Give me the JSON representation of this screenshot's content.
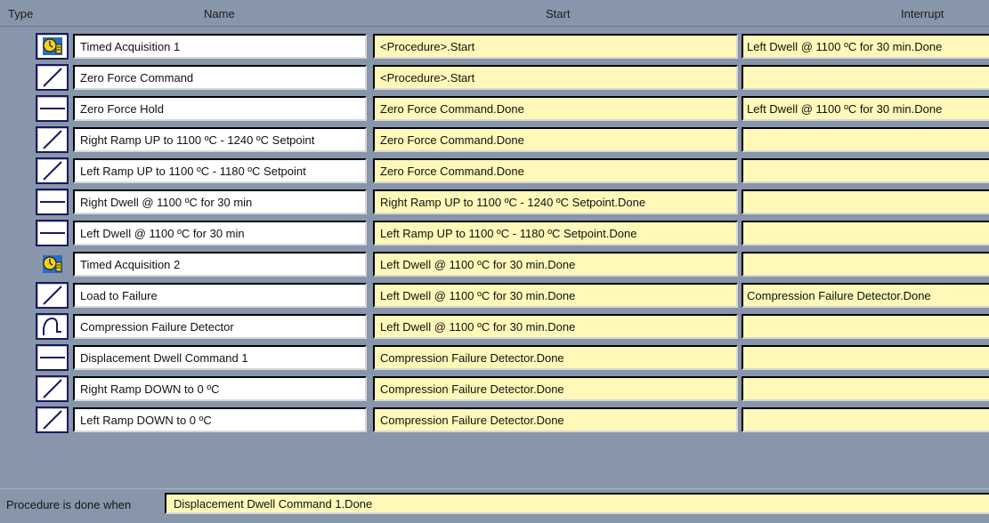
{
  "header": {
    "type": "Type",
    "name": "Name",
    "start": "Start",
    "interrupt": "Interrupt"
  },
  "rows": [
    {
      "icon": "timed-acquisition-icon",
      "name": "Timed Acquisition 1",
      "start": "<Procedure>.Start",
      "interrupt": "Left Dwell @ 1100 ºC for 30 min.Done"
    },
    {
      "icon": "ramp-icon",
      "name": "Zero Force Command",
      "start": "<Procedure>.Start",
      "interrupt": ""
    },
    {
      "icon": "dwell-icon",
      "name": "Zero Force Hold",
      "start": "Zero Force Command.Done",
      "interrupt": "Left Dwell @ 1100 ºC for 30 min.Done"
    },
    {
      "icon": "ramp-icon",
      "name": "Right Ramp UP to 1100 ºC - 1240 ºC Setpoint",
      "start": "Zero Force Command.Done",
      "interrupt": ""
    },
    {
      "icon": "ramp-icon",
      "name": "Left Ramp UP to 1100 ºC - 1180 ºC Setpoint",
      "start": "Zero Force Command.Done",
      "interrupt": ""
    },
    {
      "icon": "dwell-icon",
      "name": "Right Dwell @ 1100 ºC for 30 min",
      "start": "Right Ramp UP to 1100 ºC - 1240 ºC Setpoint.Done",
      "interrupt": ""
    },
    {
      "icon": "dwell-icon",
      "name": "Left Dwell @ 1100 ºC for 30 min",
      "start": "Left Ramp UP to 1100 ºC - 1180 ºC Setpoint.Done",
      "interrupt": ""
    },
    {
      "icon": "timed-acquisition-icon",
      "name": "Timed Acquisition 2",
      "start": "Left Dwell @ 1100 ºC for 30 min.Done",
      "interrupt": ""
    },
    {
      "icon": "ramp-icon",
      "name": "Load to Failure",
      "start": "Left Dwell @ 1100 ºC for 30 min.Done",
      "interrupt": "Compression Failure Detector.Done"
    },
    {
      "icon": "failure-detector-icon",
      "name": "Compression Failure Detector",
      "start": "Left Dwell @ 1100 ºC for 30 min.Done",
      "interrupt": ""
    },
    {
      "icon": "dwell-icon",
      "name": "Displacement Dwell Command 1",
      "start": "Compression Failure Detector.Done",
      "interrupt": ""
    },
    {
      "icon": "ramp-icon",
      "name": "Right Ramp DOWN to 0 ºC",
      "start": "Compression Failure Detector.Done",
      "interrupt": ""
    },
    {
      "icon": "ramp-icon",
      "name": "Left Ramp DOWN to 0 ºC",
      "start": "Compression Failure Detector.Done",
      "interrupt": ""
    }
  ],
  "footer": {
    "label": "Procedure is done when",
    "value": "Displacement Dwell Command 1.Done"
  },
  "colors": {
    "background": "#8896ab",
    "field_yellow": "#fff8b8",
    "icon_border": "#1a1a60"
  }
}
